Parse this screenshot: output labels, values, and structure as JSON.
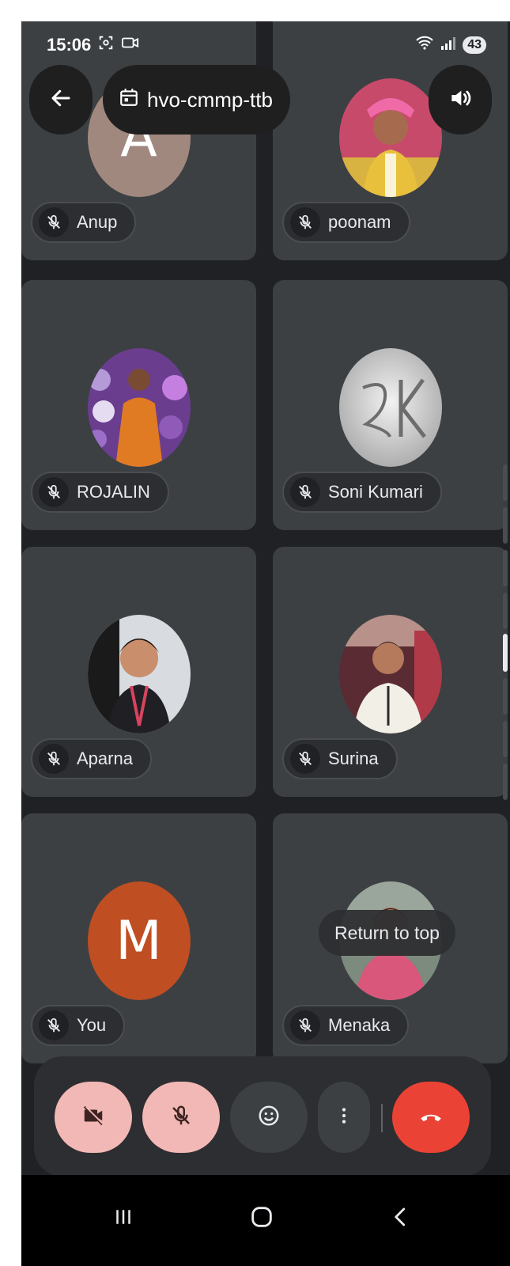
{
  "status_bar": {
    "time": "15:06",
    "left_icons": [
      "screenshot-icon",
      "video-record-icon"
    ],
    "right_icons": [
      "wifi-icon",
      "signal-icon"
    ],
    "battery": "43"
  },
  "header": {
    "meeting_code": "hvo-cmmp-ttb",
    "back_icon": "arrow-left-icon",
    "calendar_icon": "calendar-icon",
    "volume_icon": "speaker-icon"
  },
  "participants": [
    {
      "name": "Anup",
      "avatar_type": "letter",
      "avatar_letter": "A",
      "avatar_color": "#a1887f",
      "mic": "off"
    },
    {
      "name": "poonam",
      "avatar_type": "photo",
      "mic": "off"
    },
    {
      "name": "ROJALIN",
      "avatar_type": "photo",
      "mic": "off"
    },
    {
      "name": "Soni Kumari",
      "avatar_type": "photo",
      "mic": "off"
    },
    {
      "name": "Aparna",
      "avatar_type": "photo",
      "mic": "off"
    },
    {
      "name": "Surina",
      "avatar_type": "photo",
      "mic": "off"
    },
    {
      "name": "You",
      "avatar_type": "letter",
      "avatar_letter": "M",
      "avatar_color": "#bf4e22",
      "mic": "off"
    },
    {
      "name": "Menaka",
      "avatar_type": "photo",
      "mic": "off"
    }
  ],
  "return_to_top": "Return to top",
  "controls": {
    "camera": {
      "icon": "video-off-icon",
      "state": "off",
      "color": "#f2b8b5"
    },
    "microphone": {
      "icon": "mic-off-icon",
      "state": "off",
      "color": "#f2b8b5"
    },
    "reactions": {
      "icon": "emoji-icon"
    },
    "more": {
      "icon": "more-vert-icon"
    },
    "end_call": {
      "icon": "call-end-icon",
      "color": "#ea4335"
    }
  },
  "nav_bar": [
    "recents-icon",
    "home-icon",
    "back-icon"
  ]
}
